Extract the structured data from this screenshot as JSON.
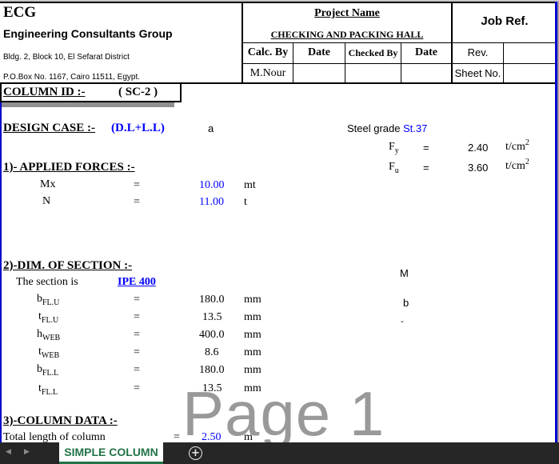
{
  "header": {
    "company_abbr": "ECG",
    "company_name": "Engineering Consultants Group",
    "address_line1": "Bldg. 2, Block 10, El Sefarat District",
    "address_line2": "P.O.Box No. 1167, Cairo 11511, Egypt.",
    "project_name_label": "Project Name",
    "project_name": "CHECKING AND PACKING HALL",
    "job_ref_label": "Job Ref.",
    "calc_by_label": "Calc. By",
    "date_label_1": "Date",
    "checked_by_label": "Checked By",
    "date_label_2": "Date",
    "rev_label": "Rev.",
    "calc_by_value": "M.Nour",
    "sheet_no_label": "Sheet No."
  },
  "column_id": {
    "label": "COLUMN ID :-",
    "value": "( SC-2 )"
  },
  "design_case": {
    "label": "DESIGN CASE :-",
    "value": "(D.L+L.L)",
    "note": "a"
  },
  "steel": {
    "grade_label": "Steel grade",
    "grade_value": "St.37",
    "fy_symbol": "F",
    "fy_sub": "y",
    "fy_eq": "=",
    "fy_value": "2.40",
    "fy_unit": "t/cm",
    "fy_unit_sup": "2",
    "fu_symbol": "F",
    "fu_sub": "u",
    "fu_eq": "=",
    "fu_value": "3.60",
    "fu_unit": "t/cm",
    "fu_unit_sup": "2"
  },
  "applied_forces": {
    "title": "1)- APPLIED FORCES :-",
    "rows": [
      {
        "symbol": "Mx",
        "eq": "=",
        "value": "10.00",
        "unit": "mt"
      },
      {
        "symbol": "N",
        "eq": "=",
        "value": "11.00",
        "unit": "t"
      }
    ]
  },
  "section": {
    "title": "2)-DIM. OF SECTION :-",
    "section_label": "The section is",
    "section_value": "IPE 400",
    "rows": [
      {
        "symbol": "b",
        "sub": "FL.U",
        "eq": "=",
        "value": "180.0",
        "unit": "mm"
      },
      {
        "symbol": "t",
        "sub": "FL.U",
        "eq": "=",
        "value": "13.5",
        "unit": "mm"
      },
      {
        "symbol": "h",
        "sub": "WEB",
        "eq": "=",
        "value": "400.0",
        "unit": "mm"
      },
      {
        "symbol": "t",
        "sub": "WEB",
        "eq": "=",
        "value": "8.6",
        "unit": "mm"
      },
      {
        "symbol": "b",
        "sub": "FL.L",
        "eq": "=",
        "value": "180.0",
        "unit": "mm"
      },
      {
        "symbol": "t",
        "sub": "FL.L",
        "eq": "=",
        "value": "13.5",
        "unit": "mm"
      }
    ],
    "side_labels": {
      "m": "M",
      "b": "b",
      "dash": "-"
    }
  },
  "column_data": {
    "title": "3)-COLUMN DATA :-",
    "length_label": "Total length of column",
    "length_eq": "=",
    "length_value": "2.50",
    "length_unit": "m"
  },
  "watermark": "Page 1",
  "sheet_tabs": {
    "active": "SIMPLE COLUMN",
    "add_icon": "+",
    "prev_icon": "◀",
    "next_icon": "▶"
  },
  "colors": {
    "input_blue": "#0000ff",
    "tab_green": "#217346",
    "tabbar_bg": "#262626",
    "page_border": "#0000cc"
  }
}
